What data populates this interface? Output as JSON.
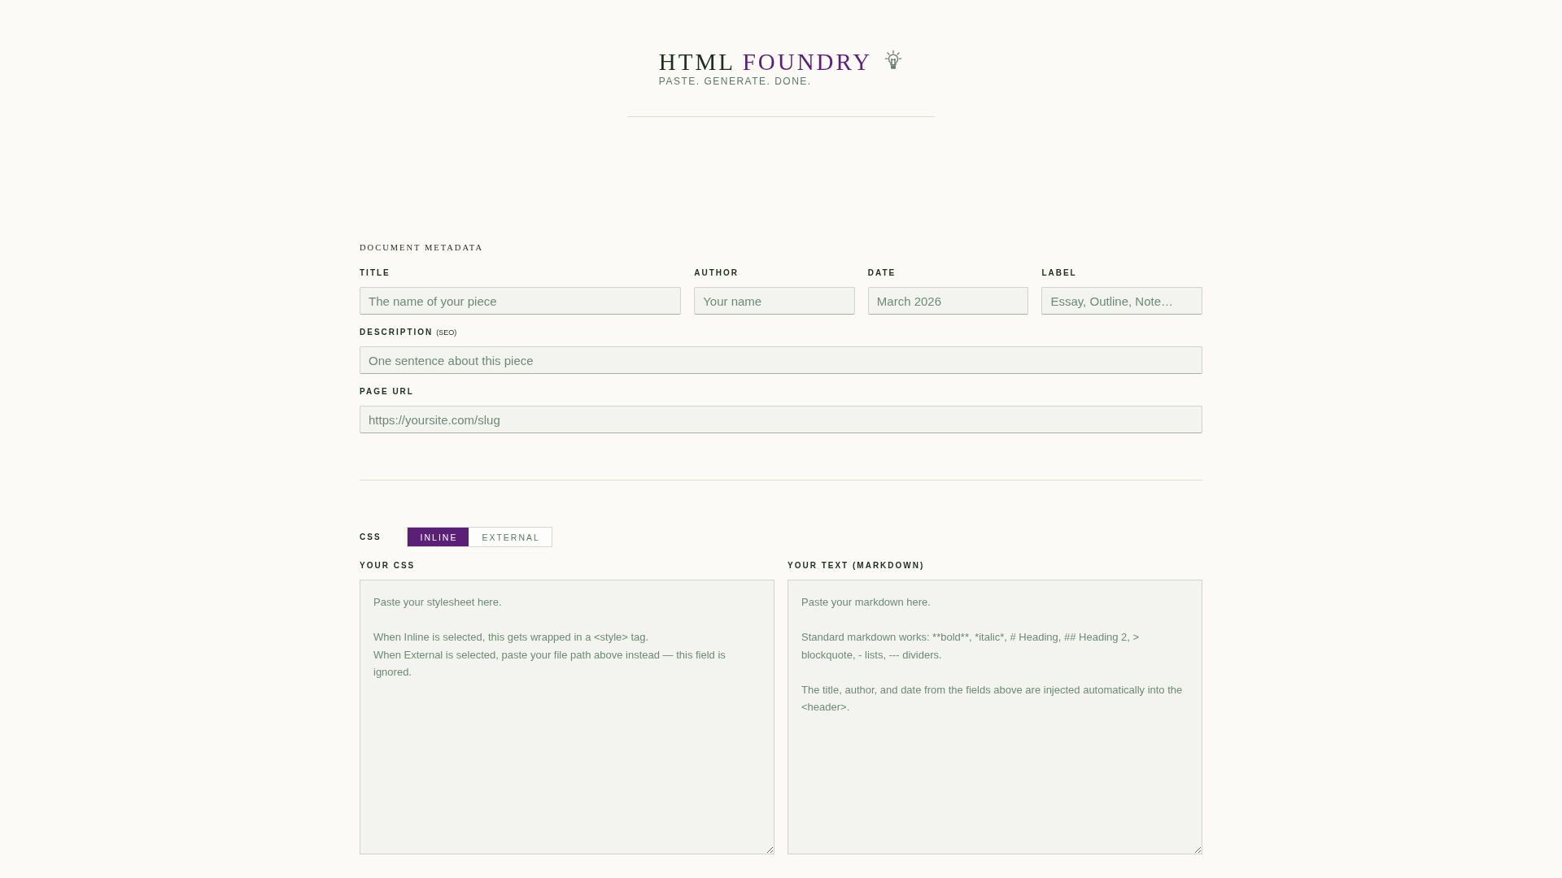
{
  "header": {
    "brand": {
      "primary": "HTML",
      "accent": "FOUNDRY"
    },
    "tagline": "PASTE. GENERATE. DONE."
  },
  "metadata": {
    "heading": "DOCUMENT METADATA",
    "rows": [
      {
        "fields": [
          {
            "label": "TITLE",
            "placeholder": "The name of your piece"
          },
          {
            "label": "AUTHOR",
            "placeholder": "Your name"
          },
          {
            "label": "DATE",
            "placeholder": "March 2026"
          },
          {
            "label": "LABEL",
            "placeholder": "Essay, Outline, Note…"
          }
        ]
      },
      {
        "fields": [
          {
            "label": "DESCRIPTION",
            "note": "(SEO)",
            "placeholder": "One sentence about this piece"
          }
        ]
      },
      {
        "fields": [
          {
            "label": "PAGE URL",
            "placeholder": "https://yoursite.com/slug"
          }
        ]
      }
    ]
  },
  "css_mode": {
    "label": "CSS",
    "options": [
      {
        "label": "INLINE",
        "selected": true
      },
      {
        "label": "EXTERNAL",
        "selected": false
      }
    ]
  },
  "editors": [
    {
      "label": "YOUR CSS",
      "placeholder": "Paste your stylesheet here.\n\nWhen Inline is selected, this gets wrapped in a <style> tag.\nWhen External is selected, paste your file path above instead — this field is ignored."
    },
    {
      "label": "YOUR TEXT (MARKDOWN)",
      "placeholder": "Paste your markdown here.\n\nStandard markdown works: **bold**, *italic*, # Heading, ## Heading 2, > blockquote, - lists, --- dividers.\n\nThe title, author, and date from the fields above are injected automatically into the <header>."
    }
  ]
}
